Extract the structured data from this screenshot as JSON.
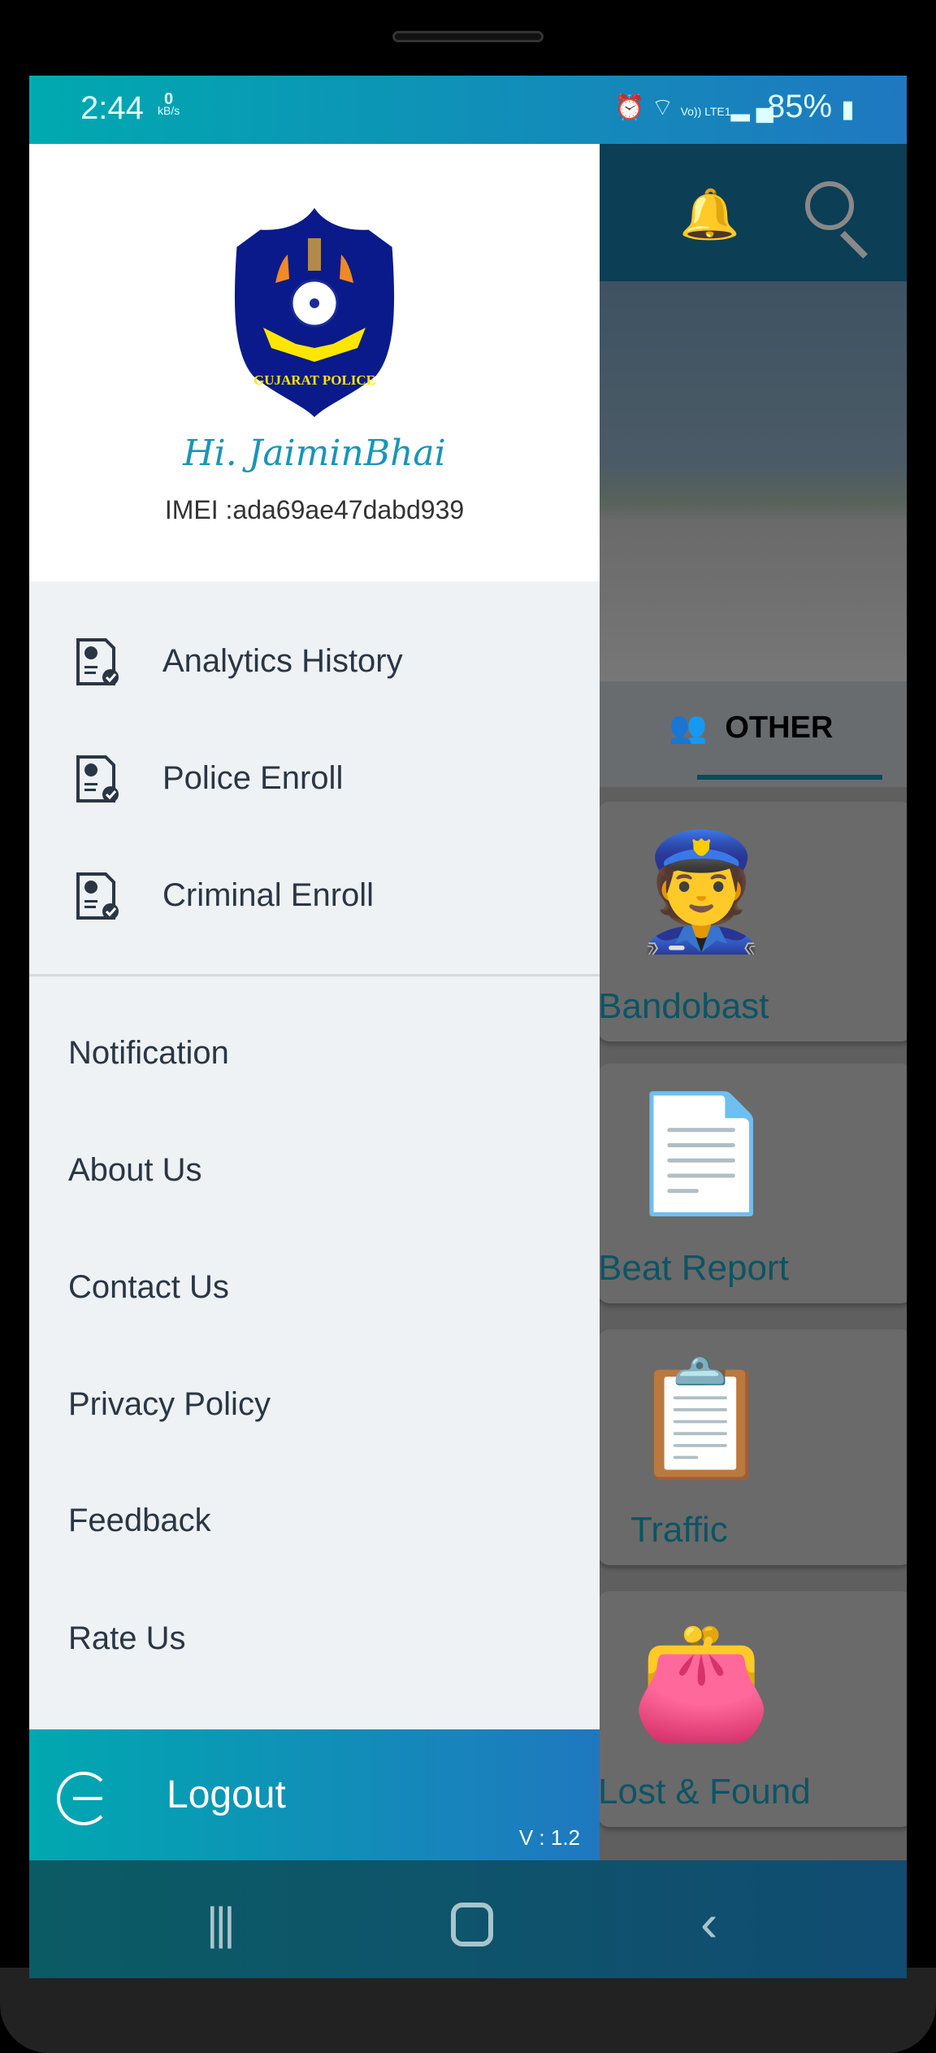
{
  "status_bar": {
    "time": "2:44",
    "net_speed_value": "0",
    "net_speed_unit": "kB/s",
    "icons": [
      "alarm-icon",
      "wifi-icon",
      "volte-lte-icon",
      "signal-icon"
    ],
    "volte_label": "Vo)) LTE1",
    "battery": "85%"
  },
  "drawer": {
    "logo_text": "GUJARAT POLICE",
    "greeting": "Hi. JaiminBhai",
    "imei": "IMEI :ada69ae47dabd939",
    "primary_items": [
      {
        "label": "Analytics History",
        "icon": "report-check-icon"
      },
      {
        "label": "Police Enroll",
        "icon": "report-check-icon"
      },
      {
        "label": "Criminal Enroll",
        "icon": "report-check-icon"
      }
    ],
    "secondary_items": [
      {
        "label": "Notification"
      },
      {
        "label": "About Us"
      },
      {
        "label": "Contact Us"
      },
      {
        "label": "Privacy Policy"
      },
      {
        "label": "Feedback"
      },
      {
        "label": "Rate Us"
      }
    ],
    "logout_label": "Logout",
    "version": "V : 1.2"
  },
  "background_app": {
    "tab_label": "OTHER",
    "cards": [
      {
        "label": "Bandobast"
      },
      {
        "label": "Beat Report"
      },
      {
        "label": "Traffic"
      },
      {
        "label": "Lost & Found"
      }
    ]
  },
  "colors": {
    "accent_start": "#00a9b0",
    "accent_end": "#1f78c0",
    "appbar": "#0c3e55",
    "text": "#2a3645"
  }
}
